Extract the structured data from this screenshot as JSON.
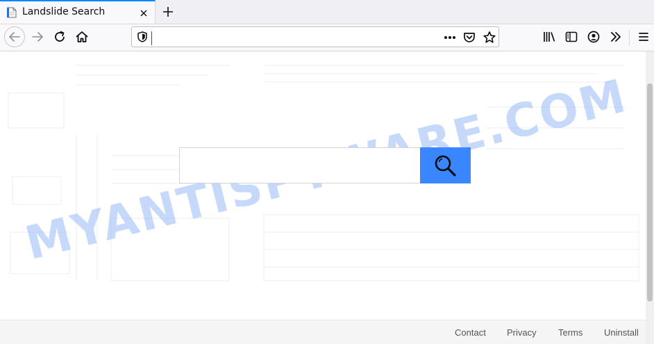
{
  "browser": {
    "tab": {
      "title": "Landslide Search",
      "favicon": "page-icon",
      "close_icon": "close-icon"
    },
    "new_tab_icon": "plus-icon",
    "toolbar": {
      "back_icon": "back-arrow-icon",
      "forward_icon": "forward-arrow-icon",
      "reload_icon": "reload-icon",
      "home_icon": "home-icon",
      "url_value": "",
      "shield_icon": "shield-icon",
      "page_actions_icon": "more-dots-icon",
      "pocket_icon": "pocket-icon",
      "bookmark_icon": "star-icon",
      "library_icon": "library-icon",
      "sidebar_icon": "sidebar-icon",
      "account_icon": "account-icon",
      "overflow_icon": "chevrons-icon",
      "menu_icon": "hamburger-icon"
    }
  },
  "page": {
    "search": {
      "value": "",
      "button_icon": "magnifier-icon",
      "button_color": "#3a86ff"
    },
    "watermark": "MYANTISPYWARE.COM",
    "footer": {
      "links": [
        "Contact",
        "Privacy",
        "Terms",
        "Uninstall"
      ]
    }
  },
  "colors": {
    "tab_accent": "#0a84ff",
    "watermark": "#78a5f5"
  }
}
